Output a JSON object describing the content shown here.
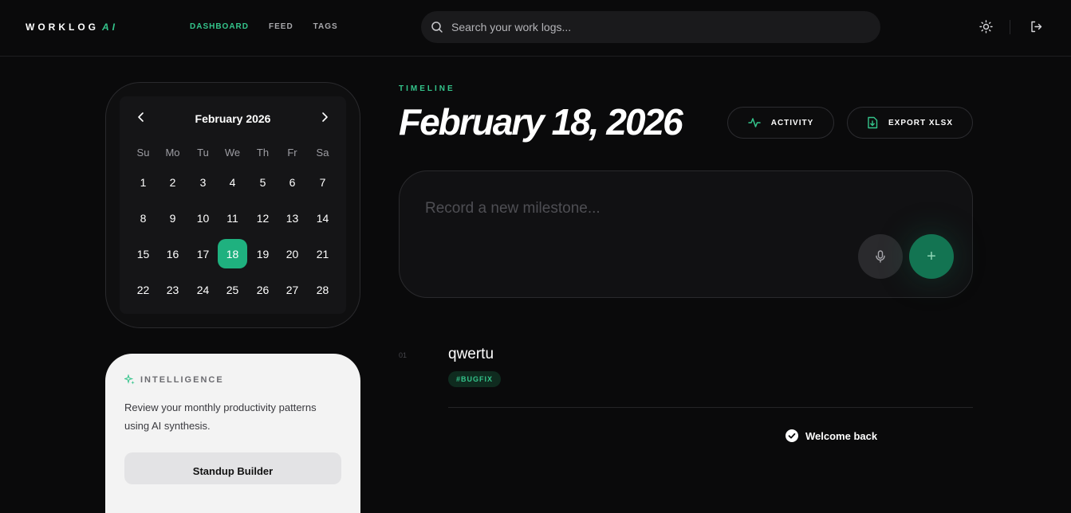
{
  "brand": {
    "name": "WORKLOG",
    "suffix": "AI"
  },
  "nav": {
    "dashboard": "DASHBOARD",
    "feed": "FEED",
    "tags": "TAGS"
  },
  "search": {
    "placeholder": "Search your work logs..."
  },
  "header_icons": {
    "theme": "sun-icon",
    "logout": "logout-icon"
  },
  "calendar": {
    "month_label": "February 2026",
    "weekdays": [
      "Su",
      "Mo",
      "Tu",
      "We",
      "Th",
      "Fr",
      "Sa"
    ],
    "days": [
      "1",
      "2",
      "3",
      "4",
      "5",
      "6",
      "7",
      "8",
      "9",
      "10",
      "11",
      "12",
      "13",
      "14",
      "15",
      "16",
      "17",
      "18",
      "19",
      "20",
      "21",
      "22",
      "23",
      "24",
      "25",
      "26",
      "27",
      "28"
    ],
    "selected_day": "18"
  },
  "intelligence": {
    "title": "INTELLIGENCE",
    "description": "Review your monthly productivity patterns using AI synthesis.",
    "button_label": "Standup Builder"
  },
  "timeline": {
    "eyebrow": "TIMELINE",
    "date_title": "February 18, 2026",
    "activity_label": "ACTIVITY",
    "export_label": "EXPORT XLSX"
  },
  "composer": {
    "placeholder": "Record a new milestone...",
    "add_symbol": "+"
  },
  "entries": [
    {
      "number": "01",
      "title": "qwertu",
      "tag": "#BUGFIX"
    }
  ],
  "toast": {
    "message": "Welcome back"
  },
  "colors": {
    "accent": "#34c48b",
    "selected_day": "#1fb17f",
    "background": "#0a0a0b"
  }
}
